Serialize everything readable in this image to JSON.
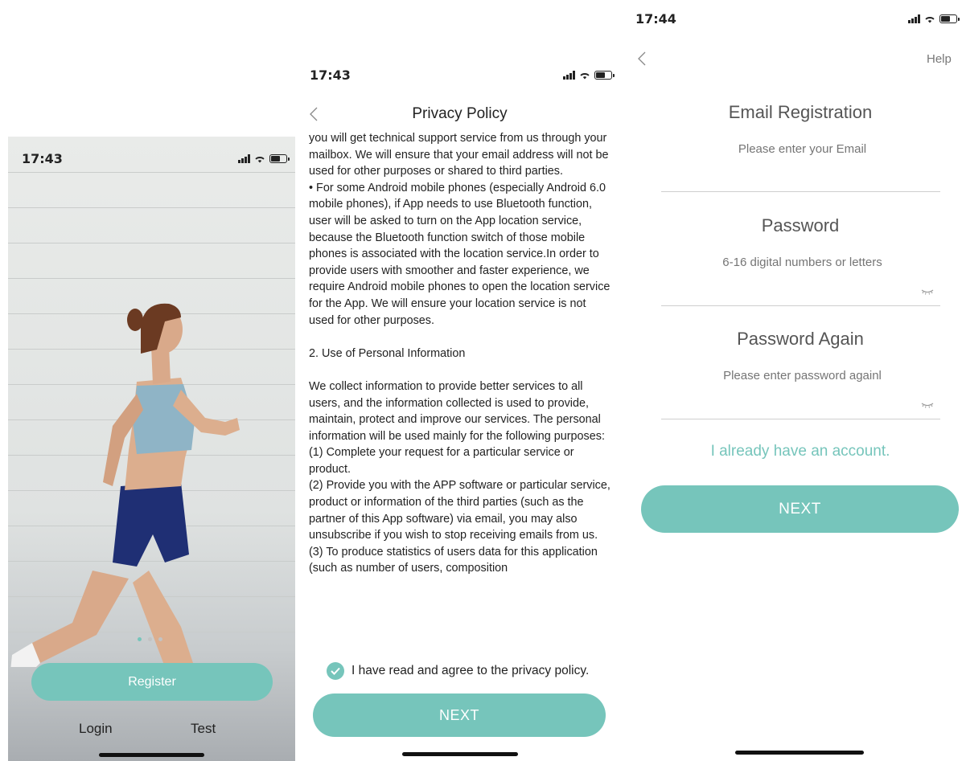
{
  "colors": {
    "accent": "#76c5bb",
    "text": "#222222",
    "muted": "#666666"
  },
  "screen1": {
    "status_time": "17:43",
    "register_label": "Register",
    "login_label": "Login",
    "test_label": "Test",
    "page_dots": 3,
    "active_dot": 0
  },
  "screen2": {
    "status_time": "17:43",
    "title": "Privacy Policy",
    "policy_paragraphs": [
      "you will get technical support service from us through your mailbox. We will ensure that your email address will not be used for other purposes or shared to third parties.",
      "• For some Android mobile phones (especially Android 6.0 mobile phones), if App needs to use Bluetooth function, user will be asked to turn on the App location service, because the Bluetooth function switch of those mobile phones is associated with the location service.In order to provide users with smoother and faster experience, we require Android mobile phones to open the location service for the App. We will ensure your location service is not used for other purposes.",
      "",
      "2. Use of Personal Information",
      "",
      "We collect information to provide better services to all users, and the information collected is used to provide, maintain, protect and improve our services. The personal information will be used mainly for the following purposes:",
      "(1) Complete your request for a particular service or product.",
      "(2) Provide you with the APP software or particular service, product or information of the third parties (such as the partner of this App software) via email, you may also unsubscribe if you wish to stop receiving emails from us.",
      "(3) To produce statistics of users data for this application (such as number of users, composition"
    ],
    "agree_label": "I have read and agree to the privacy policy.",
    "agree_checked": true,
    "next_label": "NEXT"
  },
  "screen3": {
    "status_time": "17:44",
    "help_label": "Help",
    "email_title": "Email Registration",
    "email_placeholder": "Please enter your Email",
    "password_title": "Password",
    "password_placeholder": "6-16 digital numbers or letters",
    "password_again_title": "Password Again",
    "password_again_placeholder": "Please enter password againl",
    "have_account_link": "I already have an account.",
    "next_label": "NEXT"
  }
}
